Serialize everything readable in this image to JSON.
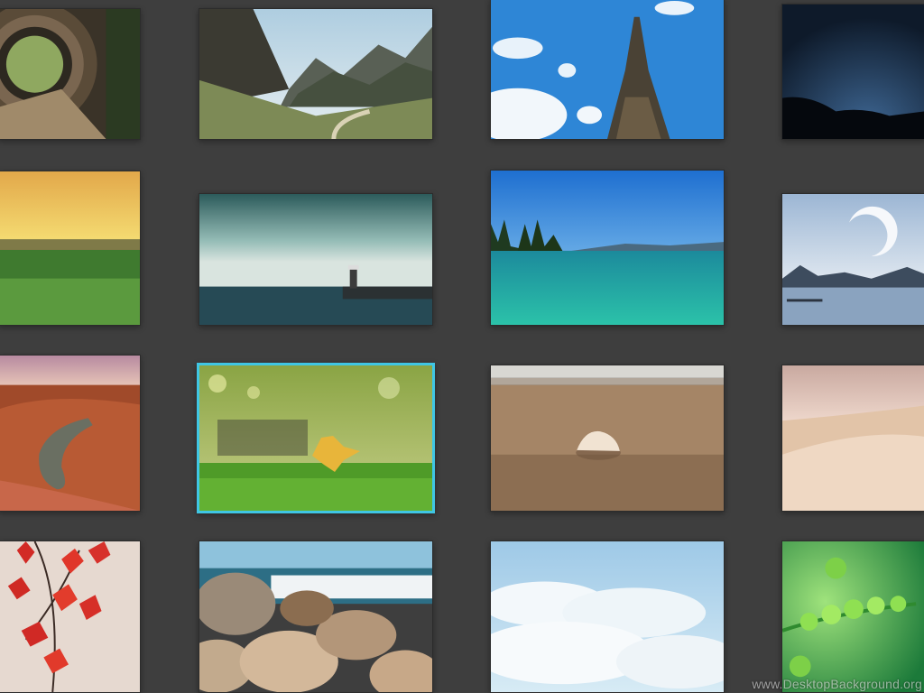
{
  "gallery": {
    "selected": "autumn-leaf",
    "items": [
      {
        "id": "tunnel-path",
        "icon": "tunnel-image"
      },
      {
        "id": "mountain-valley",
        "icon": "mountain-image"
      },
      {
        "id": "eiffel-tower",
        "icon": "eiffel-tower-image"
      },
      {
        "id": "night-sky",
        "icon": "night-sky-image"
      },
      {
        "id": "wheat-sunset",
        "icon": "field-image"
      },
      {
        "id": "lighthouse",
        "icon": "lighthouse-image"
      },
      {
        "id": "turquoise-lake",
        "icon": "lake-image"
      },
      {
        "id": "moon-lake",
        "icon": "moon-image"
      },
      {
        "id": "canyon-river",
        "icon": "canyon-image"
      },
      {
        "id": "autumn-leaf",
        "icon": "leaf-image"
      },
      {
        "id": "seashell-beach",
        "icon": "seashell-image"
      },
      {
        "id": "desert-dunes",
        "icon": "desert-image"
      },
      {
        "id": "red-maple",
        "icon": "maple-image"
      },
      {
        "id": "beach-rocks",
        "icon": "rocks-image"
      },
      {
        "id": "clouds",
        "icon": "clouds-image"
      },
      {
        "id": "green-fern",
        "icon": "fern-image"
      }
    ]
  },
  "colors": {
    "background": "#3e3e3e",
    "selection": "#3fc6e4"
  },
  "watermark": {
    "text": "www.DesktopBackground.org"
  }
}
